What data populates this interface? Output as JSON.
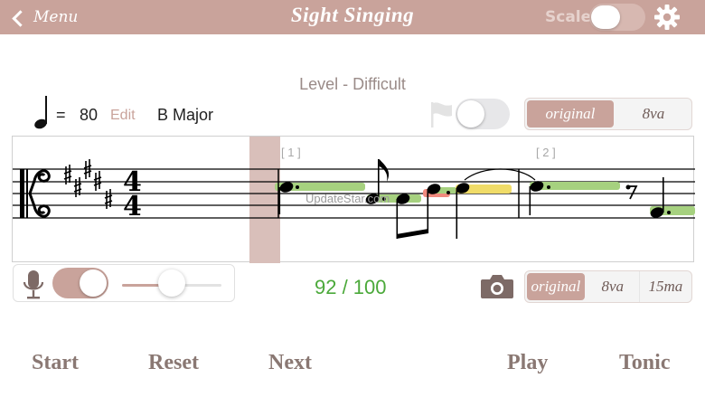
{
  "header": {
    "menu_label": "Menu",
    "title": "Sight Singing",
    "scale_label": "Scale",
    "scale_on": false
  },
  "level": "Level - Difficult",
  "tempo": {
    "equals": "=",
    "value": "80",
    "edit_label": "Edit"
  },
  "key_signature": "B Major",
  "flag_toggle_on": false,
  "octave_display": {
    "options": [
      "original",
      "8va"
    ],
    "selected": 0
  },
  "staff": {
    "time_signature": {
      "top": "4",
      "bottom": "4"
    },
    "measure_labels": [
      "[ 1 ]",
      "[ 2 ]"
    ]
  },
  "watermark": "UpdateStar.com",
  "audio": {
    "mic_on": true,
    "volume": 0.5
  },
  "score": "92 / 100",
  "octave_playback": {
    "options": [
      "original",
      "8va",
      "15ma"
    ],
    "selected": 0
  },
  "buttons": {
    "start": "Start",
    "reset": "Reset",
    "next": "Next",
    "play": "Play",
    "tonic": "Tonic"
  },
  "colors": {
    "accent": "#c9a39b",
    "score": "#4ba93a",
    "pitch_good": "#a6d17f",
    "pitch_warn": "#f0dc68",
    "pitch_bad": "#f08a7e"
  }
}
